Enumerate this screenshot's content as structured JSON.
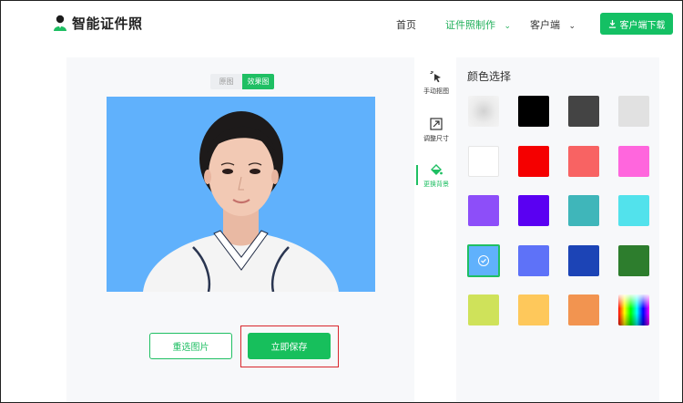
{
  "header": {
    "brand": "智能证件照",
    "nav": {
      "home": "首页",
      "make": "证件照制作",
      "client": "客户端"
    },
    "download": "客户端下载"
  },
  "preview": {
    "toggle": [
      "原图",
      "效果图"
    ],
    "active_toggle": "效果图",
    "background_color": "#60b1fc"
  },
  "actions": {
    "reselect": "重选图片",
    "save": "立即保存"
  },
  "tools": [
    {
      "label": "手动抠图"
    },
    {
      "label": "调整尺寸"
    },
    {
      "label": "更换背景"
    }
  ],
  "color_panel": {
    "title": "颜色选择",
    "selected_index": 12,
    "colors": [
      "#eeeeee",
      "#000000",
      "#444444",
      "#e1e1e1",
      "#ffffff",
      "#f50000",
      "#f86363",
      "#ff66dd",
      "#8d4ef9",
      "#5a00f2",
      "#3fb6ba",
      "#52e2ec",
      "#60b1fc",
      "#5e72f8",
      "#1c44b6",
      "#2d7d2d",
      "#cfe25a",
      "#fec85b",
      "#f29450",
      "gradient"
    ]
  }
}
